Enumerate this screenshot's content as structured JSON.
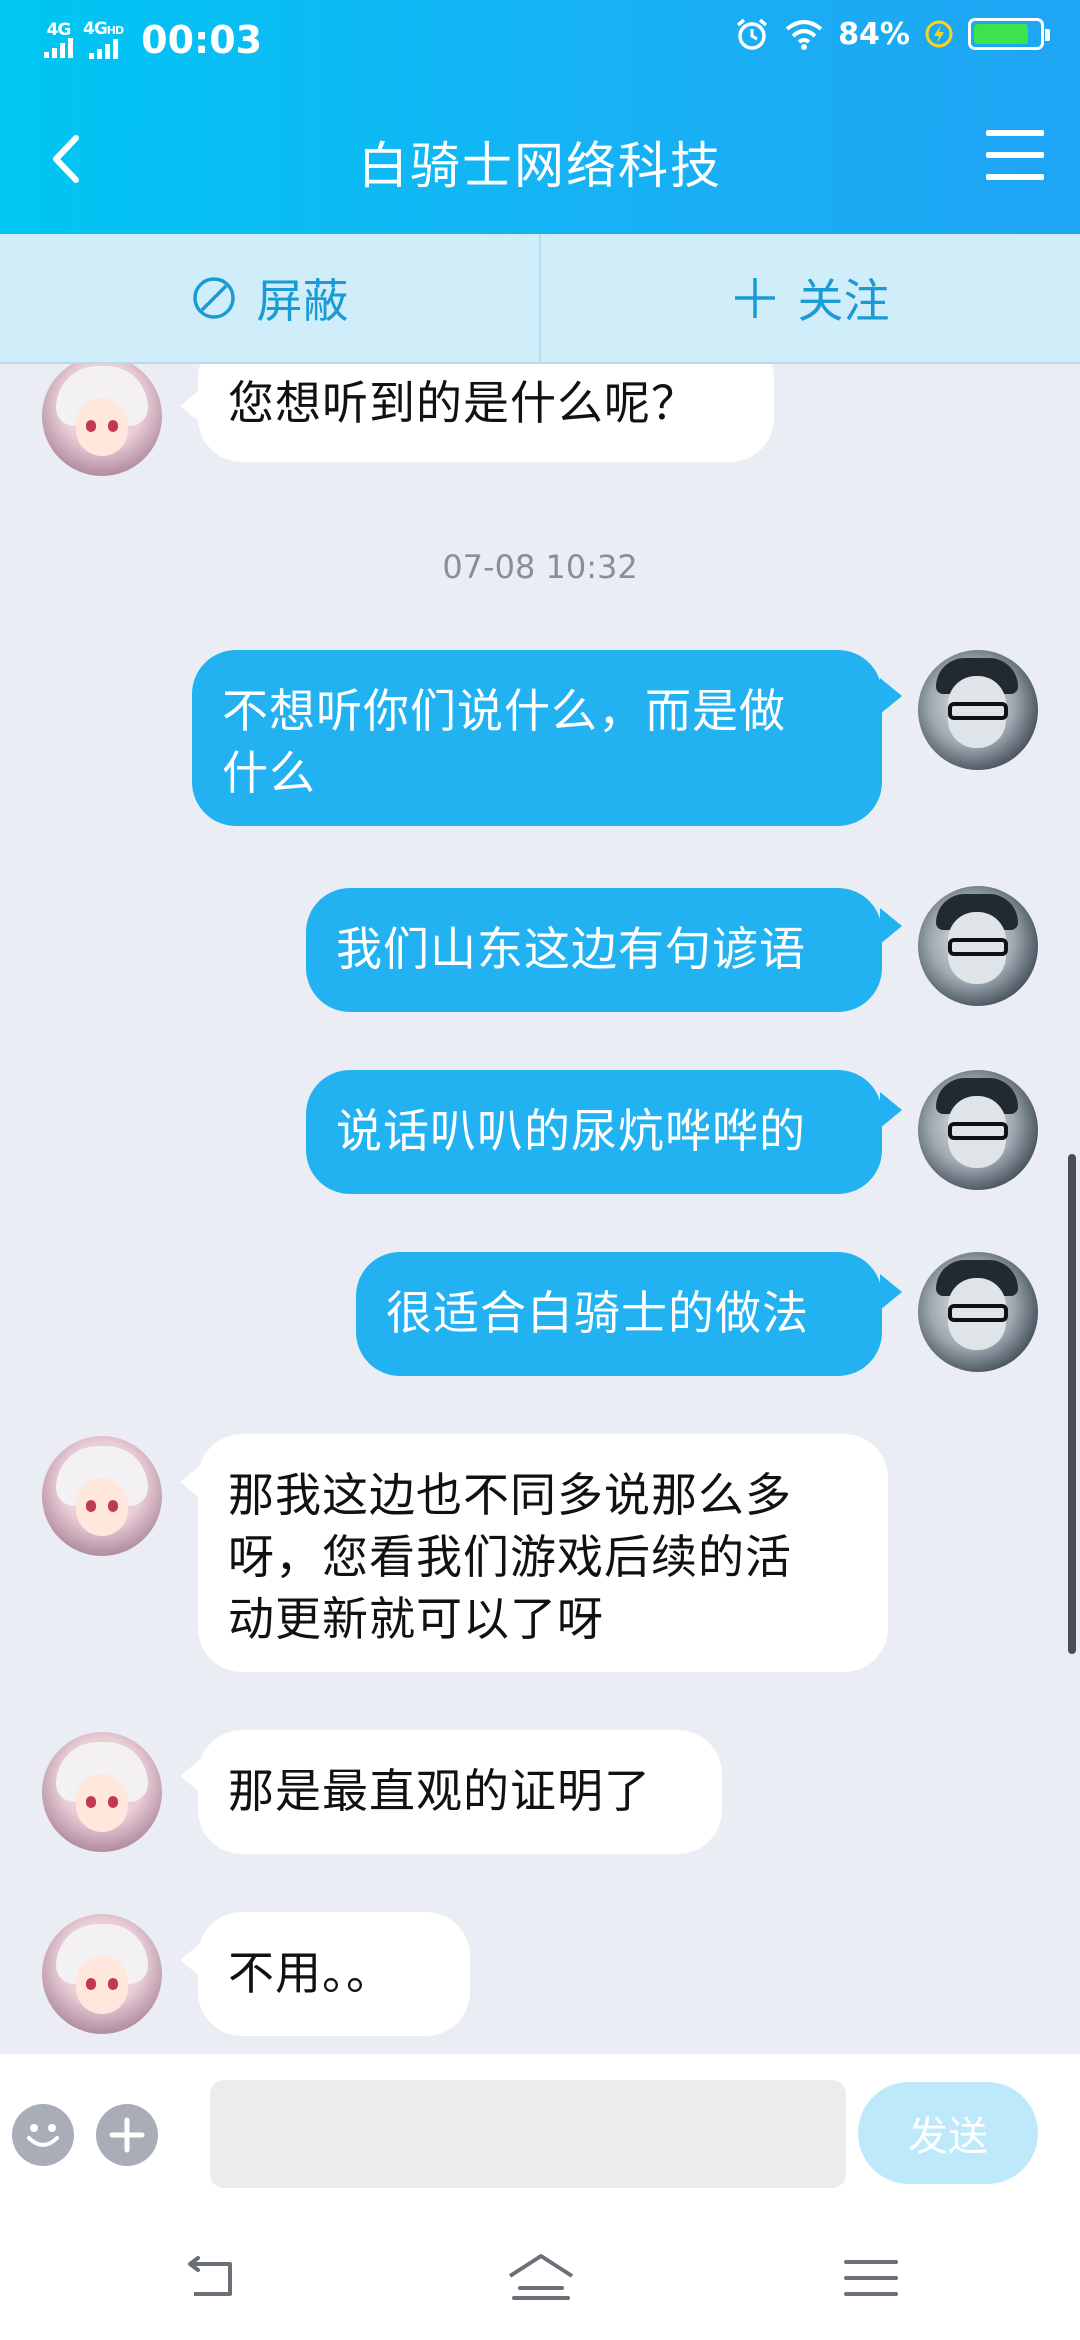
{
  "status_bar": {
    "signal_1": "4G",
    "signal_2": "4G",
    "signal_2_sup": "HD",
    "time": "00:03",
    "battery_percent": "84%",
    "battery_level": 0.84
  },
  "header": {
    "title": "白骑士网络科技"
  },
  "actions": {
    "block_label": "屏蔽",
    "follow_label": "关注"
  },
  "colors": {
    "header_gradient_start": "#00c6f3",
    "header_gradient_end": "#1ea5f4",
    "outgoing_bubble": "#22b2f2",
    "incoming_bubble": "#ffffff",
    "chat_background": "#eaedf4",
    "action_bar": "#cfeefa",
    "accent_text": "#1a9bd6"
  },
  "chat": {
    "messages": [
      {
        "side": "in",
        "text": "您想听到的是什么呢？"
      },
      {
        "type": "timestamp",
        "text": "07-08 10:32"
      },
      {
        "side": "out",
        "text": "不想听你们说什么，而是做\n什么"
      },
      {
        "side": "out",
        "text": "我们山东这边有句谚语"
      },
      {
        "side": "out",
        "text": "说话叭叭的尿炕哗哗的"
      },
      {
        "side": "out",
        "text": "很适合白骑士的做法"
      },
      {
        "side": "in",
        "text": "那我这边也不同多说那么多\n呀，您看我们游戏后续的活\n动更新就可以了呀"
      },
      {
        "side": "in",
        "text": "那是最直观的证明了"
      },
      {
        "side": "in",
        "text": "不用。。"
      }
    ]
  },
  "input": {
    "placeholder": "",
    "send_label": "发送"
  },
  "icons": {
    "back": "back-arrow-icon",
    "menu": "hamburger-menu-icon",
    "block": "block-circle-icon",
    "follow": "plus-icon",
    "emoji": "emoji-icon",
    "more": "plus-circle-icon",
    "nav_back": "nav-back-icon",
    "nav_home": "nav-home-icon",
    "nav_menu": "nav-menu-icon"
  }
}
